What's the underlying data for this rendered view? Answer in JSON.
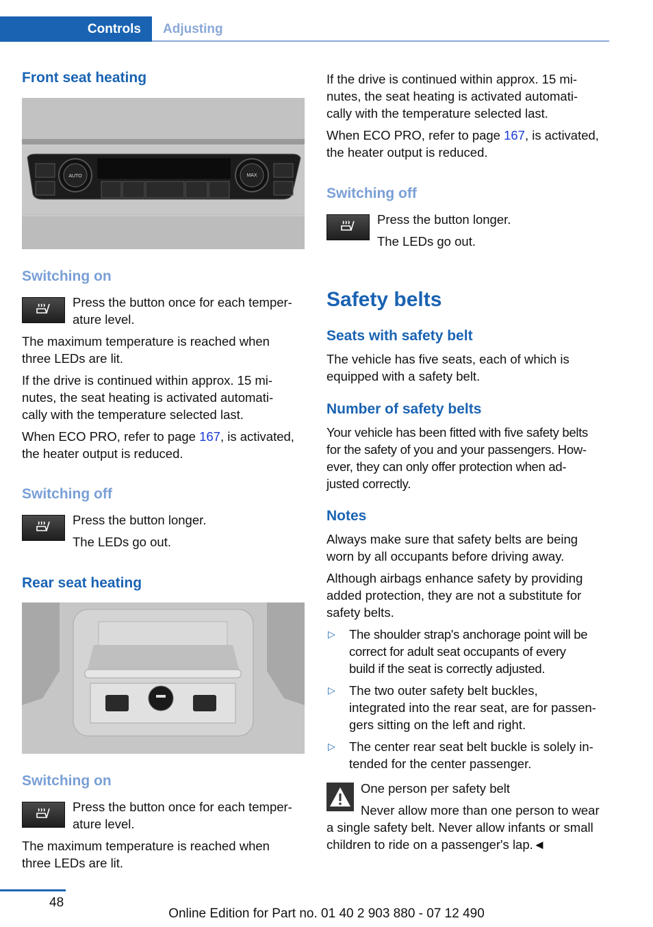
{
  "header": {
    "tabs": [
      {
        "label": "Controls",
        "active": true
      },
      {
        "label": "Adjusting",
        "active": false
      }
    ]
  },
  "left": {
    "front_heading": "Front seat heating",
    "front_image": "climate-control-panel-illustration",
    "switching_on_1": {
      "heading": "Switching on",
      "icon": "seat-heating-button",
      "lines": [
        "Press the button once for each temper-",
        "ature level."
      ]
    },
    "para_max_1": [
      "The maximum temperature is reached when",
      "three LEDs are lit."
    ],
    "para_drive_1": [
      "If the drive is continued within approx. 15 mi-",
      "nutes, the seat heating is activated automati-",
      "cally with the temperature selected last."
    ],
    "para_eco_1": {
      "before": "When ECO PRO, refer to page ",
      "link": "167",
      "after": ", is activated,",
      "line2": "the heater output is reduced."
    },
    "switching_off_1": {
      "heading": "Switching off",
      "icon": "seat-heating-button",
      "line1": "Press the button longer.",
      "line2": "The LEDs go out."
    },
    "rear_heading": "Rear seat heating",
    "rear_image": "rear-console-illustration",
    "switching_on_2": {
      "heading": "Switching on",
      "icon": "seat-heating-button",
      "lines": [
        "Press the button once for each temper-",
        "ature level."
      ]
    },
    "para_max_2": [
      "The maximum temperature is reached when",
      "three LEDs are lit."
    ]
  },
  "right": {
    "para_drive_2": [
      "If the drive is continued within approx. 15 mi-",
      "nutes, the seat heating is activated automati-",
      "cally with the temperature selected last."
    ],
    "para_eco_2": {
      "before": "When ECO PRO, refer to page ",
      "link": "167",
      "after": ", is activated,",
      "line2": "the heater output is reduced."
    },
    "switching_off_2": {
      "heading": "Switching off",
      "icon": "seat-heating-button",
      "line1": "Press the button longer.",
      "line2": "The LEDs go out."
    },
    "section_title": "Safety belts",
    "seats_heading": "Seats with safety belt",
    "seats_text": [
      "The vehicle has five seats, each of which is",
      "equipped with a safety belt."
    ],
    "number_heading": "Number of safety belts",
    "number_text": [
      "Your vehicle has been fitted with five safety belts",
      "for the safety of you and your passengers. How-",
      "ever, they can only offer protection when ad-",
      "justed correctly."
    ],
    "notes_heading": "Notes",
    "notes_text_1": [
      "Always make sure that safety belts are being",
      "worn by all occupants before driving away."
    ],
    "notes_text_2": [
      "Although airbags enhance safety by providing",
      "added protection, they are not a substitute for",
      "safety belts."
    ],
    "bullets": [
      {
        "mark": "▷",
        "lines": [
          "The shoulder strap's anchorage point will be",
          "correct for adult seat occupants of every",
          "build if the seat is correctly adjusted."
        ]
      },
      {
        "mark": "▷",
        "lines": [
          "The two outer safety belt buckles,",
          "integrated into the rear seat, are for passen-",
          "gers sitting on the left and right."
        ]
      },
      {
        "mark": "▷",
        "lines": [
          "The center rear seat belt buckle is solely in-",
          "tended for the center passenger."
        ]
      }
    ],
    "warning": {
      "icon": "warning-triangle",
      "title": "One person per safety belt",
      "lines": [
        "Never allow more than one person to wear",
        "a single safety belt. Never allow infants or small",
        "children to ride on a passenger's lap.◄"
      ]
    }
  },
  "footer": {
    "page_number": "48",
    "edition": "Online Edition for Part no. 01 40 2 903 880 - 07 12 490"
  }
}
